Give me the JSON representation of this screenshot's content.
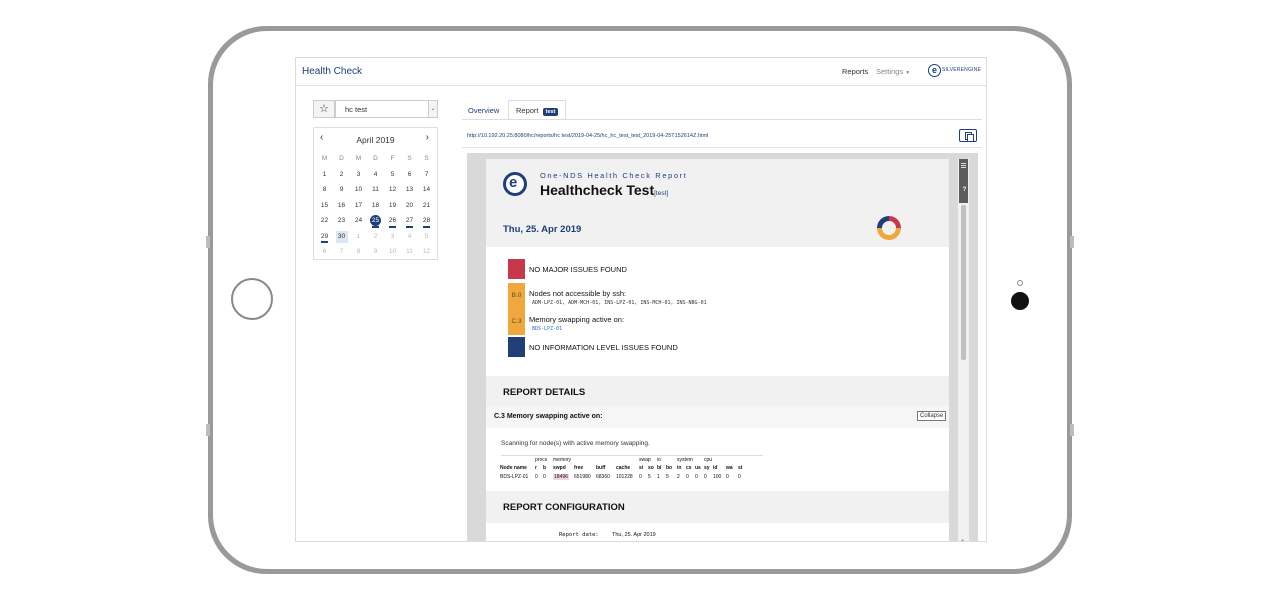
{
  "app": {
    "brand": "Health Check",
    "nav_reports": "Reports",
    "nav_settings": "Settings",
    "logo_text": "SILVERENGINE"
  },
  "sidebar": {
    "favorite_icon": "star-icon",
    "select_value": "hc test",
    "calendar": {
      "title": "April 2019",
      "weekdays": [
        "M",
        "D",
        "M",
        "D",
        "F",
        "S",
        "S"
      ],
      "days": [
        "1",
        "2",
        "3",
        "4",
        "5",
        "6",
        "7",
        "8",
        "9",
        "10",
        "11",
        "12",
        "13",
        "14",
        "15",
        "16",
        "17",
        "18",
        "19",
        "20",
        "21",
        "22",
        "23",
        "24",
        "25",
        "26",
        "27",
        "28",
        "29",
        "30",
        "1",
        "2",
        "3",
        "4",
        "5",
        "6",
        "7",
        "8",
        "9",
        "10",
        "11",
        "12"
      ],
      "selected_day": "25",
      "today_day": "30"
    }
  },
  "tabs": {
    "overview": "Overview",
    "report": "Report",
    "report_badge": "test"
  },
  "url": "http://10.192.20.25:8080/hc/reports/hc test/2019-04-25/hc_hc_test_test_2019-04-25T152614Z.html",
  "report": {
    "subtitle": "One-NDS Health Check Report",
    "title": "Healthcheck Test",
    "title_tag": "[test]",
    "date": "Thu, 25. Apr 2019",
    "issues": [
      {
        "code": "",
        "color": "#c8384b",
        "label": "NO MAJOR ISSUES FOUND",
        "nodes": ""
      },
      {
        "code": "B.0",
        "color": "#f0a73e",
        "label": "Nodes not accessible by ssh:",
        "nodes": "ADM-LPZ-01, ADM-MCH-01, INS-LPZ-01, INS-MCH-01, INS-NBG-01"
      },
      {
        "code": "C.3",
        "color": "#f0a73e",
        "label": "Memory swapping active on:",
        "nodes": "BDS-LPZ-01"
      },
      {
        "code": "",
        "color": "#1f3e7a",
        "label": "NO INFORMATION LEVEL ISSUES FOUND",
        "nodes": ""
      }
    ],
    "details_title": "REPORT DETAILS",
    "detail_heading": "C.3 Memory swapping active on:",
    "collapse_label": "Collapse",
    "detail_desc": "Scanning for node(s) with active memory swapping.",
    "vmstat": {
      "groups": [
        "procs",
        "memory",
        "swap",
        "io",
        "system",
        "cpu"
      ],
      "headers": [
        "Node name",
        "r",
        "b",
        "swpd",
        "free",
        "buff",
        "cache",
        "si",
        "so",
        "bi",
        "bo",
        "in",
        "cs",
        "us",
        "sy",
        "id",
        "wa",
        "st"
      ],
      "row": [
        "BDS-LPZ-01",
        "0",
        "0",
        "18496",
        "651980",
        "68360",
        "101228",
        "0",
        "5",
        "1",
        "5",
        "2",
        "0",
        "0",
        "0",
        "100",
        "0",
        "0"
      ]
    },
    "config_title": "REPORT CONFIGURATION",
    "config_date_label": "Report date:",
    "config_date_value": "Thu, 25. Apr 2019"
  }
}
